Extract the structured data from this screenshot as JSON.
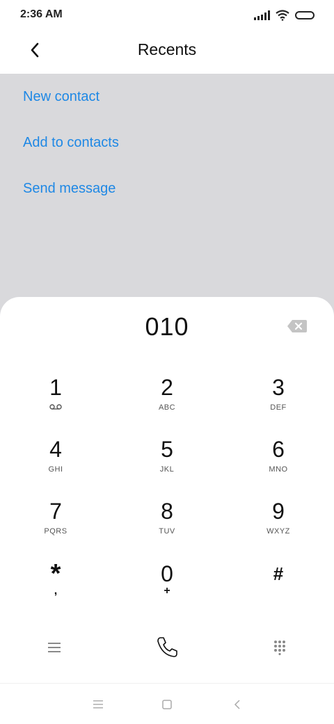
{
  "status": {
    "time": "2:36 AM"
  },
  "header": {
    "title": "Recents"
  },
  "menu": {
    "items": [
      {
        "label": "New contact"
      },
      {
        "label": "Add to contacts"
      },
      {
        "label": "Send message"
      }
    ]
  },
  "dialer": {
    "number": "010",
    "keys": [
      {
        "digit": "1",
        "letters": ""
      },
      {
        "digit": "2",
        "letters": "ABC"
      },
      {
        "digit": "3",
        "letters": "DEF"
      },
      {
        "digit": "4",
        "letters": "GHI"
      },
      {
        "digit": "5",
        "letters": "JKL"
      },
      {
        "digit": "6",
        "letters": "MNO"
      },
      {
        "digit": "7",
        "letters": "PQRS"
      },
      {
        "digit": "8",
        "letters": "TUV"
      },
      {
        "digit": "9",
        "letters": "WXYZ"
      },
      {
        "digit": "*",
        "letters": ","
      },
      {
        "digit": "0",
        "letters": "+"
      },
      {
        "digit": "#",
        "letters": ""
      }
    ]
  },
  "colors": {
    "accent": "#1e88e5",
    "overlay": "#d9d9dc",
    "icon_gray": "#8a8a8a"
  }
}
